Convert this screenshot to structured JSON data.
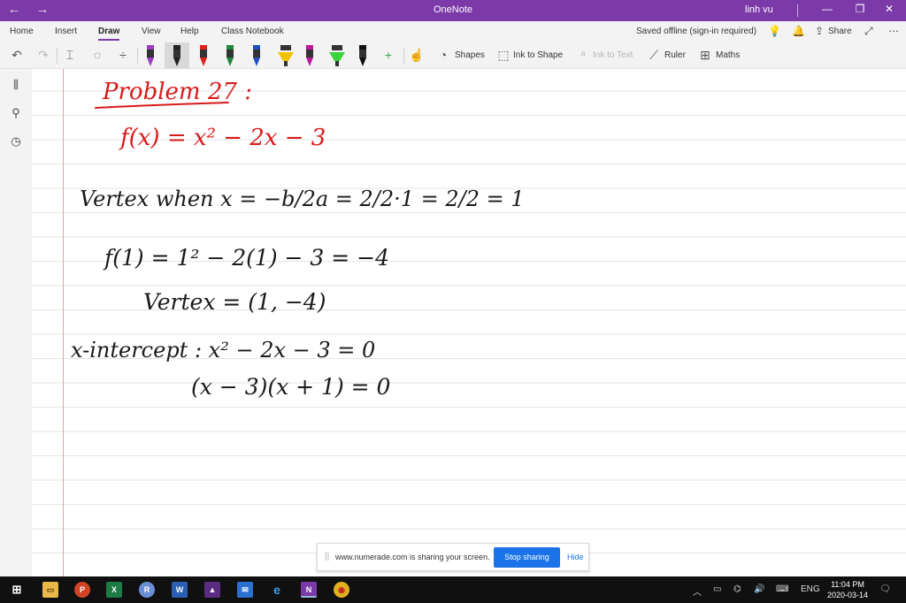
{
  "titlebar": {
    "back_icon": "←",
    "forward_icon": "→",
    "title": "OneNote",
    "user": "linh vu",
    "minimize_icon": "—",
    "restore_icon": "❐",
    "close_icon": "✕"
  },
  "ribbon": {
    "tabs": [
      "Home",
      "Insert",
      "Draw",
      "View",
      "Help",
      "Class Notebook"
    ],
    "active_tab": "Draw",
    "status": "Saved offline (sign-in required)",
    "share_label": "Share"
  },
  "toolbar": {
    "shapes_label": "Shapes",
    "ink_to_shape_label": "Ink to Shape",
    "ink_to_text_label": "Ink to Text",
    "ruler_label": "Ruler",
    "maths_label": "Maths",
    "pens": [
      {
        "name": "purple-pen",
        "color": "#9b3fc0"
      },
      {
        "name": "black-pen-selected",
        "color": "#222222"
      },
      {
        "name": "red-pen",
        "color": "#e0201c"
      },
      {
        "name": "green-pen",
        "color": "#1e8a3c"
      },
      {
        "name": "blue-pen",
        "color": "#1f4fbf"
      },
      {
        "name": "yellow-highlighter",
        "color": "#f2c200"
      },
      {
        "name": "magenta-pen",
        "color": "#c0189b"
      },
      {
        "name": "green-highlighter",
        "color": "#38d63a"
      },
      {
        "name": "black-pen",
        "color": "#111111"
      }
    ]
  },
  "notes": {
    "line1": "Problem 27 :",
    "line2": "f(x) = x² − 2x − 3",
    "line3": "Vertex when x = −b/2a = 2/2·1 = 2/2 = 1",
    "line4": "f(1) = 1² − 2(1) − 3 = −4",
    "line5": "Vertex = (1, −4)",
    "line6": "x-intercept : x² − 2x − 3 = 0",
    "line7": "(x − 3)(x + 1) = 0",
    "ink_red": "#d91a1a",
    "ink_black": "#1a1a1a"
  },
  "sharebar": {
    "grip": "||",
    "message": "www.numerade.com is sharing your screen.",
    "stop_label": "Stop sharing",
    "hide_label": "Hide"
  },
  "taskbar": {
    "lang": "ENG",
    "time": "11:04 PM",
    "date": "2020-03-14"
  }
}
